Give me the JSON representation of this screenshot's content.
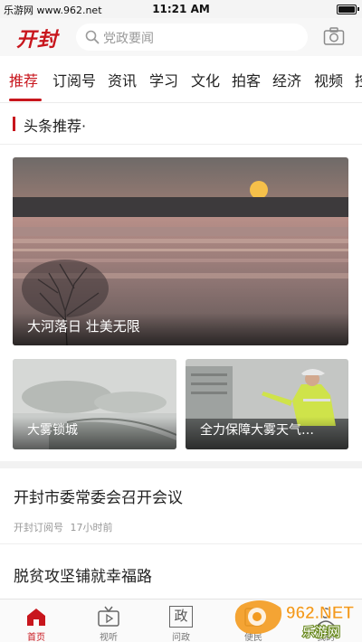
{
  "status_bar": {
    "watermark": "乐游网 www.962.net",
    "time": "11:21 AM"
  },
  "header": {
    "logo": "开封",
    "search_placeholder": "党政要闻",
    "camera_icon": "camera-icon"
  },
  "tabs": [
    {
      "label": "推荐",
      "active": true
    },
    {
      "label": "订阅号"
    },
    {
      "label": "资讯"
    },
    {
      "label": "学习"
    },
    {
      "label": "文化"
    },
    {
      "label": "拍客"
    },
    {
      "label": "经济"
    },
    {
      "label": "视频"
    },
    {
      "label": "控"
    }
  ],
  "section": {
    "title": "头条推荐·"
  },
  "hero": {
    "caption": "大河落日 壮美无限"
  },
  "thumbs": [
    {
      "caption": "大雾锁城"
    },
    {
      "caption": "全力保障大雾天气…"
    }
  ],
  "news": [
    {
      "title": "开封市委常委会召开会议",
      "source": "开封订阅号",
      "time": "17小时前"
    },
    {
      "title": "脱贫攻坚铺就幸福路"
    }
  ],
  "bottom_nav": [
    {
      "label": "首页",
      "icon": "home-icon",
      "active": true
    },
    {
      "label": "视听",
      "icon": "tv-icon"
    },
    {
      "label": "问政",
      "icon": "zheng-icon",
      "glyph": "政"
    },
    {
      "label": "便民",
      "icon": "service-icon"
    },
    {
      "label": "我的",
      "icon": "user-icon"
    }
  ],
  "site_watermark": {
    "brand": "962.NET",
    "name": "乐游网"
  },
  "colors": {
    "accent": "#c8161d"
  }
}
